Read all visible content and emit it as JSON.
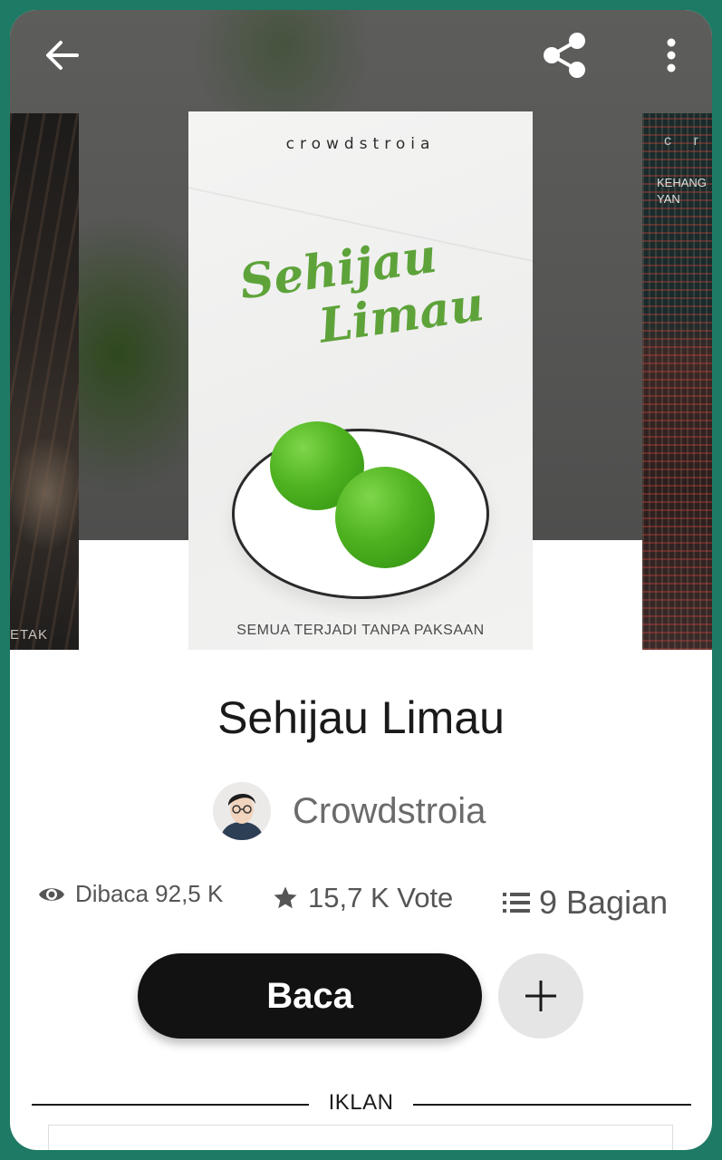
{
  "header": {
    "back_icon": "arrow-left-icon",
    "share_icon": "share-icon",
    "more_icon": "more-vertical-icon"
  },
  "carousel": {
    "left_cover_text": "ETAK",
    "right_cover_top": "c r",
    "right_cover_sub": "KEHANG YAN",
    "main_cover": {
      "author": "crowdstroia",
      "title_line1": "Sehijau",
      "title_line2": "Limau",
      "tagline": "SEMUA TERJADI TANPA PAKSAAN"
    }
  },
  "book": {
    "title": "Sehijau Limau",
    "author": "Crowdstroia",
    "reads": "Dibaca 92,5 K",
    "votes": "15,7 K Vote",
    "parts": "9 Bagian"
  },
  "actions": {
    "read_label": "Baca",
    "add_icon": "plus-icon"
  },
  "ad": {
    "label": "IKLAN"
  },
  "colors": {
    "frame": "#1e7a64",
    "button_dark": "#121212",
    "lime_green": "#5ea33a"
  }
}
